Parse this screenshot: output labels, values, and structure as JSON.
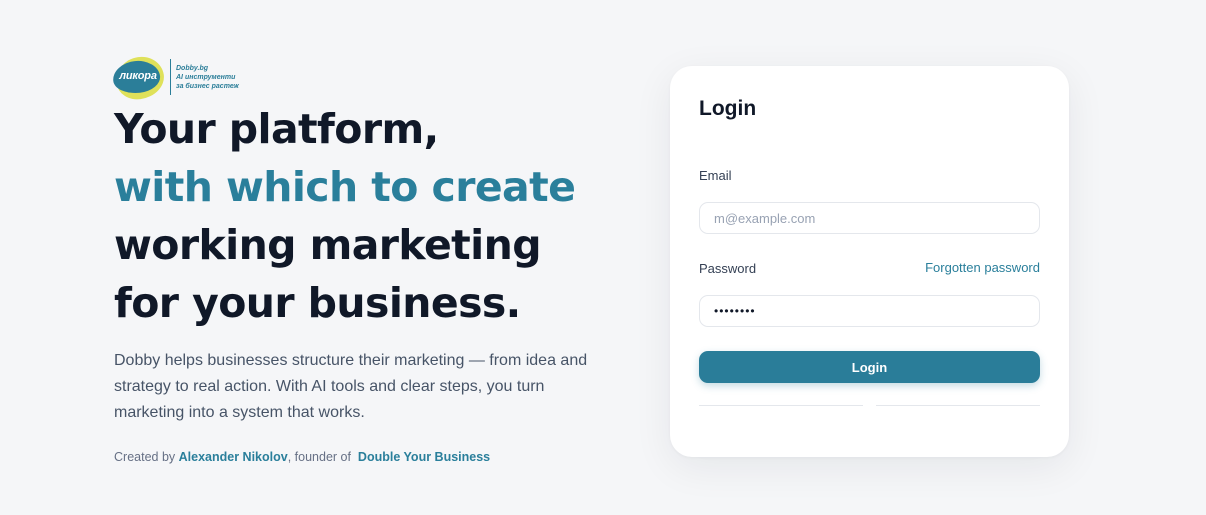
{
  "brand": {
    "name": "ликора",
    "tagline": [
      "Dobby.bg",
      "AI инструменти",
      "за бизнес растеж"
    ],
    "colors": {
      "blue": "#2b7e99",
      "yellow": "#dfe15a"
    }
  },
  "hero": {
    "title_lines": [
      {
        "text": "Your platform,",
        "accent": false
      },
      {
        "text": "with which to create",
        "accent": true
      },
      {
        "text": "working marketing",
        "accent": false
      },
      {
        "text": "for your business.",
        "accent": false
      }
    ],
    "description_lines": [
      "Dobby helps businesses structure their marketing — from idea and",
      "strategy to real action. With AI tools and clear steps, you turn",
      "marketing into a system that works."
    ],
    "credits": {
      "prefix": "Created by",
      "author": "Alexander Nikolov",
      "middle": ", founder of",
      "company": "Double Your Business"
    }
  },
  "login": {
    "title": "Login",
    "email_label": "Email",
    "email_placeholder": "m@example.com",
    "email_value": "",
    "password_label": "Password",
    "password_value": "••••••••",
    "forgot_label": "Forgotten password",
    "submit_label": "Login"
  },
  "colors": {
    "accent": "#2a7f9b",
    "heading": "#101828",
    "background": "#f5f6f8"
  }
}
